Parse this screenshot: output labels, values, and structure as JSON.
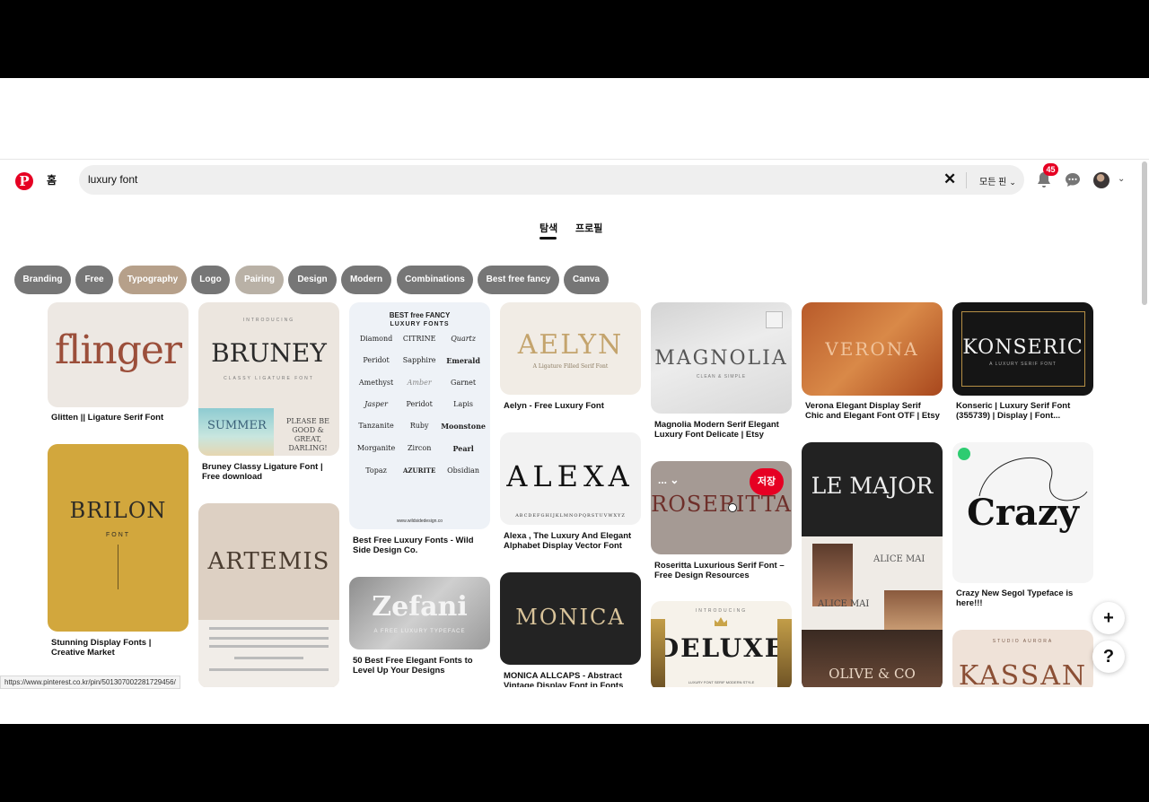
{
  "header": {
    "home_label": "홈",
    "search_value": "luxury font",
    "filter_label": "모든 핀",
    "notification_count": "45"
  },
  "tabs": [
    {
      "label": "탐색"
    },
    {
      "label": "프로필"
    }
  ],
  "chips": [
    {
      "label": "Branding",
      "color": "#767676"
    },
    {
      "label": "Free",
      "color": "#767676"
    },
    {
      "label": "Typography",
      "color": "#b6a08a"
    },
    {
      "label": "Logo",
      "color": "#767676"
    },
    {
      "label": "Pairing",
      "color": "#b9b1a6"
    },
    {
      "label": "Design",
      "color": "#767676"
    },
    {
      "label": "Modern",
      "color": "#767676"
    },
    {
      "label": "Combinations",
      "color": "#767676"
    },
    {
      "label": "Best free fancy",
      "color": "#767676"
    },
    {
      "label": "Canva",
      "color": "#767676"
    }
  ],
  "pins": {
    "flinger": {
      "word": "flinger",
      "title": "Glitten || Ligature Serif Font"
    },
    "brilon": {
      "word": "BRILON",
      "sub": "FONT",
      "title": "Stunning Display Fonts | Creative Market"
    },
    "bruney": {
      "top": "INTRODUCING",
      "word": "BRUNEY",
      "sub": "CLASSY LIGATURE FONT",
      "summer": "SUMMER",
      "please": "PLEASE BE GOOD & GREAT, DARLING!",
      "title": "Bruney Classy Ligature Font | Free download"
    },
    "artemis": {
      "word": "ARTEMIS"
    },
    "bestfree": {
      "head1": "BEST free FANCY",
      "head2": "LUXURY FONTS",
      "fonts": [
        "Diamond",
        "CITRINE",
        "Quartz",
        "Peridot",
        "Sapphire",
        "Emerald",
        "Amethyst",
        "Amber",
        "Garnet",
        "Jasper",
        "Peridot",
        "Lapis",
        "Tanzanite",
        "Ruby",
        "Moonstone",
        "Morganite",
        "Zircon",
        "Pearl",
        "Topaz",
        "AZURITE",
        "Obsidian"
      ],
      "url": "www.wildsidedesign.co",
      "title": "Best Free Luxury Fonts - Wild Side Design Co."
    },
    "zefani": {
      "word": "Zefani",
      "sub": "A FREE LUXURY TYPEFACE",
      "title": "50 Best Free Elegant Fonts to Level Up Your Designs"
    },
    "aelyn": {
      "word": "AELYN",
      "sub": "A Ligature Filled Serif Font",
      "title": "Aelyn - Free Luxury Font"
    },
    "alexa": {
      "word": "ALEXA",
      "sub": "ABCDEFGHIJKLMNOPQRSTUVWXYZ",
      "title": "Alexa , The Luxury And Elegant Alphabet Display Vector Font"
    },
    "monica": {
      "word": "MONICA",
      "title": "MONICA ALLCAPS - Abstract Vintage Display Font in Fonts"
    },
    "magnolia": {
      "word": "MAGNOLIA",
      "sub": "CLEAN & SIMPLE",
      "title": "Magnolia Modern Serif Elegant Luxury Font Delicate | Etsy"
    },
    "roseritta": {
      "word": "ROSERITTA",
      "save": "저장",
      "more": "...",
      "title": "Roseritta Luxurious Serif Font – Free Design Resources"
    },
    "deluxe": {
      "top": "INTRODUCING",
      "word": "DELUXE",
      "sub": "LUXURY FONT SERIF MODERN STYLE"
    },
    "verona": {
      "word": "VERONA",
      "title": "Verona Elegant Display Serif Chic and Elegant Font OTF | Etsy"
    },
    "lemajor": {
      "word": "LE MAJOR",
      "alice": "ALICE MAI",
      "alice2": "ALICE MAI",
      "olive": "OLIVE & CO"
    },
    "konseric": {
      "word": "KONSERIC",
      "sub": "A LUXURY SERIF FONT",
      "title": "Konseric | Luxury Serif Font (355739) | Display | Font..."
    },
    "crazy": {
      "word": "Crazy",
      "title": "Crazy New Segol Typeface is here!!!"
    },
    "kassan": {
      "top": "STUDIO AURORA",
      "word": "KASSAN"
    }
  },
  "fabs": {
    "add": "+",
    "help": "?"
  },
  "status_url": "https://www.pinterest.co.kr/pin/501307002281729456/"
}
